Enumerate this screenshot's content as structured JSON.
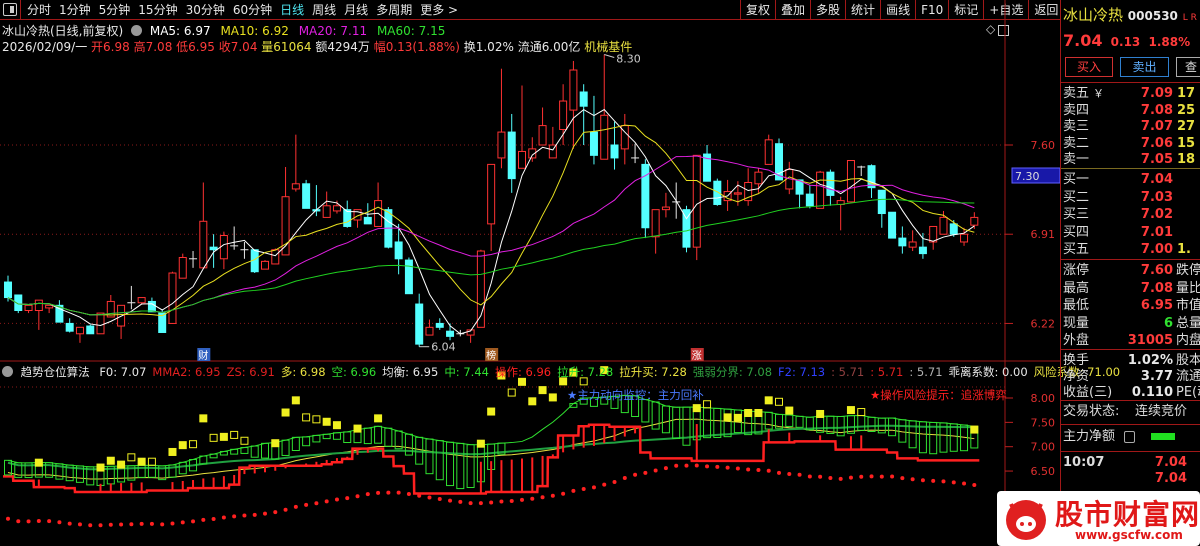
{
  "toolbar": {
    "tabs": [
      {
        "label": "分时",
        "active": false
      },
      {
        "label": "1分钟",
        "active": false
      },
      {
        "label": "5分钟",
        "active": false
      },
      {
        "label": "15分钟",
        "active": false
      },
      {
        "label": "30分钟",
        "active": false
      },
      {
        "label": "60分钟",
        "active": false
      },
      {
        "label": "日线",
        "active": true
      },
      {
        "label": "周线",
        "active": false
      },
      {
        "label": "月线",
        "active": false
      },
      {
        "label": "多周期",
        "active": false
      },
      {
        "label": "更多 >",
        "active": false
      }
    ],
    "buttons": [
      "复权",
      "叠加",
      "多股",
      "统计",
      "画线",
      "F10",
      "标记",
      "+自选",
      "返回"
    ]
  },
  "header": {
    "title": "冰山冷热(日线,前复权)",
    "ma5": "MA5: 6.97",
    "ma10": "MA10: 6.92",
    "ma20": "MA20: 7.11",
    "ma60": "MA60: 7.15",
    "date": "2026/02/09/一",
    "open": "开6.98",
    "high": "高7.08",
    "low": "低6.95",
    "close": "收7.04",
    "volume": "量61064",
    "amount": "额4294万",
    "range": "幅0.13(1.88%)",
    "turnover": "换1.02%",
    "float": "流通6.00亿",
    "sector": "机械基件"
  },
  "colors": {
    "up": "#ff3232",
    "down": "#54ffff",
    "ma5": "#ffffff",
    "ma10": "#e8e020",
    "ma20": "#e020e0",
    "ma60": "#20d020",
    "grid": "#8a1a1a"
  },
  "chart_data": [
    {
      "type": "candlestick",
      "title": "冰山冷热(日线,前复权)",
      "y_ticks": [
        "7.60",
        "6.91",
        "6.22"
      ],
      "current_price_tag": "7.30",
      "high_label": "8.30",
      "low_label": "6.04",
      "markers": [
        {
          "text": "财",
          "index": 19
        },
        {
          "text": "榜",
          "index": 47
        },
        {
          "text": "涨",
          "index": 67
        }
      ],
      "ma_periods": [
        5,
        10,
        20,
        60
      ],
      "candles": [
        [
          6.54,
          6.59,
          6.39,
          6.42
        ],
        [
          6.44,
          6.44,
          6.3,
          6.32
        ],
        [
          6.32,
          6.36,
          6.3,
          6.36
        ],
        [
          6.32,
          6.4,
          6.17,
          6.4
        ],
        [
          6.34,
          6.36,
          6.3,
          6.36
        ],
        [
          6.36,
          6.4,
          6.23,
          6.23
        ],
        [
          6.22,
          6.26,
          6.15,
          6.16
        ],
        [
          6.14,
          6.19,
          6.07,
          6.19
        ],
        [
          6.2,
          6.21,
          6.14,
          6.14
        ],
        [
          6.14,
          6.3,
          6.14,
          6.3
        ],
        [
          6.27,
          6.44,
          6.27,
          6.39
        ],
        [
          6.2,
          6.36,
          6.1,
          6.36
        ],
        [
          6.38,
          6.51,
          6.33,
          6.38
        ],
        [
          6.38,
          6.42,
          6.37,
          6.42
        ],
        [
          6.39,
          6.42,
          6.31,
          6.31
        ],
        [
          6.3,
          6.33,
          6.15,
          6.15
        ],
        [
          6.22,
          6.62,
          6.22,
          6.61
        ],
        [
          6.57,
          6.76,
          6.57,
          6.73
        ],
        [
          6.72,
          6.78,
          6.65,
          6.72
        ],
        [
          6.65,
          7.31,
          6.65,
          7.01
        ],
        [
          6.81,
          6.91,
          6.65,
          6.79
        ],
        [
          6.72,
          6.93,
          6.64,
          6.9
        ],
        [
          6.82,
          6.97,
          6.79,
          6.82
        ],
        [
          6.79,
          6.85,
          6.72,
          6.79
        ],
        [
          6.79,
          6.79,
          6.61,
          6.62
        ],
        [
          6.64,
          6.71,
          6.64,
          6.7
        ],
        [
          6.68,
          6.8,
          6.68,
          6.79
        ],
        [
          6.75,
          7.43,
          6.75,
          7.2
        ],
        [
          7.26,
          7.68,
          7.24,
          7.3
        ],
        [
          7.3,
          7.33,
          7.11,
          7.11
        ],
        [
          7.1,
          7.29,
          7.05,
          7.09
        ],
        [
          7.04,
          7.24,
          7.04,
          7.13
        ],
        [
          7.09,
          7.17,
          7.07,
          7.13
        ],
        [
          7.1,
          7.17,
          6.96,
          6.97
        ],
        [
          7.02,
          7.1,
          6.96,
          7.1
        ],
        [
          7.04,
          7.15,
          6.99,
          6.99
        ],
        [
          6.97,
          7.31,
          6.97,
          7.17
        ],
        [
          7.1,
          7.12,
          6.8,
          6.81
        ],
        [
          6.85,
          6.99,
          6.6,
          6.72
        ],
        [
          6.71,
          6.73,
          6.45,
          6.45
        ],
        [
          6.37,
          6.45,
          6.04,
          6.06
        ],
        [
          6.13,
          6.25,
          6.13,
          6.19
        ],
        [
          6.22,
          6.26,
          6.17,
          6.19
        ],
        [
          6.16,
          6.22,
          6.09,
          6.12
        ],
        [
          6.14,
          6.17,
          6.12,
          6.14
        ],
        [
          6.13,
          6.17,
          6.07,
          6.17
        ],
        [
          6.19,
          6.79,
          6.19,
          6.78
        ],
        [
          6.99,
          7.45,
          6.78,
          7.45
        ],
        [
          7.5,
          8.19,
          7.42,
          7.7
        ],
        [
          7.7,
          7.84,
          7.23,
          7.34
        ],
        [
          7.42,
          8.06,
          7.42,
          7.55
        ],
        [
          7.5,
          7.66,
          7.47,
          7.57
        ],
        [
          7.6,
          7.89,
          7.6,
          7.75
        ],
        [
          7.5,
          7.74,
          7.5,
          7.6
        ],
        [
          7.72,
          8.07,
          7.6,
          7.94
        ],
        [
          7.87,
          8.25,
          7.57,
          8.18
        ],
        [
          8.01,
          8.07,
          7.6,
          7.9
        ],
        [
          7.7,
          7.98,
          7.45,
          7.52
        ],
        [
          7.49,
          8.3,
          7.49,
          7.83
        ],
        [
          7.6,
          7.78,
          7.41,
          7.5
        ],
        [
          7.57,
          7.84,
          7.45,
          7.75
        ],
        [
          7.5,
          7.61,
          7.46,
          7.5
        ],
        [
          7.45,
          7.49,
          6.88,
          6.96
        ],
        [
          6.89,
          7.1,
          6.76,
          7.1
        ],
        [
          7.1,
          7.23,
          7.04,
          7.12
        ],
        [
          7.16,
          7.31,
          7.03,
          7.16
        ],
        [
          7.1,
          7.13,
          6.77,
          6.81
        ],
        [
          6.81,
          7.52,
          6.71,
          7.52
        ],
        [
          7.53,
          7.6,
          7.32,
          7.32
        ],
        [
          7.32,
          7.34,
          7.13,
          7.14
        ],
        [
          7.17,
          7.33,
          7.09,
          7.24
        ],
        [
          7.22,
          7.32,
          7.13,
          7.23
        ],
        [
          7.17,
          7.42,
          7.13,
          7.31
        ],
        [
          7.3,
          7.42,
          7.23,
          7.39
        ],
        [
          7.45,
          7.68,
          7.45,
          7.64
        ],
        [
          7.61,
          7.65,
          7.33,
          7.33
        ],
        [
          7.26,
          7.47,
          7.22,
          7.41
        ],
        [
          7.33,
          7.33,
          7.11,
          7.22
        ],
        [
          7.22,
          7.29,
          7.11,
          7.13
        ],
        [
          7.11,
          7.4,
          7.11,
          7.39
        ],
        [
          7.39,
          7.41,
          7.13,
          7.21
        ],
        [
          7.14,
          7.2,
          6.94,
          7.17
        ],
        [
          7.16,
          7.48,
          7.16,
          7.48
        ],
        [
          7.43,
          7.44,
          7.36,
          7.43
        ],
        [
          7.44,
          7.45,
          7.19,
          7.27
        ],
        [
          7.25,
          7.25,
          6.96,
          7.07
        ],
        [
          7.08,
          7.08,
          6.88,
          6.88
        ],
        [
          6.88,
          6.97,
          6.76,
          6.82
        ],
        [
          6.81,
          6.94,
          6.78,
          6.85
        ],
        [
          6.81,
          6.92,
          6.72,
          6.76
        ],
        [
          6.85,
          6.97,
          6.79,
          6.97
        ],
        [
          6.91,
          7.09,
          6.91,
          7.04
        ],
        [
          6.99,
          7.02,
          6.89,
          6.91
        ],
        [
          6.85,
          6.96,
          6.82,
          6.91
        ],
        [
          6.98,
          7.08,
          6.95,
          7.04
        ]
      ]
    },
    {
      "type": "line",
      "title": "趋势仓位算法",
      "y_ticks": [
        "8.00",
        "7.50",
        "7.00",
        "6.50"
      ],
      "legend": [
        {
          "text": "F0: 7.07",
          "color": "#e8e8e8"
        },
        {
          "text": "MMA2: 6.95",
          "color": "#e02020"
        },
        {
          "text": "ZS: 6.91",
          "color": "#e02020"
        },
        {
          "text": "多: 6.98",
          "color": "#e8e040"
        },
        {
          "text": "空: 6.96",
          "color": "#30e030"
        },
        {
          "text": "均衡: 6.95",
          "color": "#e8e8e8"
        },
        {
          "text": "中: 7.44",
          "color": "#30e030"
        },
        {
          "text": "操作: 6.96",
          "color": "#ff2020"
        },
        {
          "text": "拉升: 7.28",
          "color": "#30e030"
        },
        {
          "text": "拉升买: 7.28",
          "color": "#e8e040"
        },
        {
          "text": "强弱分界: 7.08",
          "color": "#30a040"
        },
        {
          "text": "F2: 7.13",
          "color": "#3040ff"
        },
        {
          "text": ": 5.71",
          "color": "#904040"
        },
        {
          "text": ": 5.71",
          "color": "#e02020"
        },
        {
          "text": ": 5.71",
          "color": "#b0b0b0"
        },
        {
          "text": "乖离系数: 0.00",
          "color": "#e8e8e8"
        },
        {
          "text": "风险系数: 71.00",
          "color": "#e8e040"
        }
      ],
      "notes": {
        "main_force": "★主力动向监控：主力回补",
        "risk": "★操作风险提示：追涨博弈"
      }
    }
  ],
  "quote": {
    "name": "冰山冷热",
    "code": "000530",
    "lr": "L R",
    "price": "7.04",
    "change": "0.13",
    "pct": "1.88%",
    "buttons": [
      "买入",
      "卖出",
      "查"
    ],
    "asks": [
      {
        "label": "卖五",
        "price": "7.09",
        "vol": "17"
      },
      {
        "label": "卖四",
        "price": "7.08",
        "vol": "25"
      },
      {
        "label": "卖三",
        "price": "7.07",
        "vol": "27"
      },
      {
        "label": "卖二",
        "price": "7.06",
        "vol": "15"
      },
      {
        "label": "卖一",
        "price": "7.05",
        "vol": "18"
      }
    ],
    "bids": [
      {
        "label": "买一",
        "price": "7.04",
        "vol": ""
      },
      {
        "label": "买二",
        "price": "7.03",
        "vol": ""
      },
      {
        "label": "买三",
        "price": "7.02",
        "vol": ""
      },
      {
        "label": "买四",
        "price": "7.01",
        "vol": ""
      },
      {
        "label": "买五",
        "price": "7.00",
        "vol": "1."
      }
    ],
    "stats": [
      {
        "label": "涨停",
        "value": "7.60",
        "extra": "跌停",
        "color": "#ff3b3b"
      },
      {
        "label": "最高",
        "value": "7.08",
        "extra": "量比",
        "color": "#ff3b3b"
      },
      {
        "label": "最低",
        "value": "6.95",
        "extra": "市值",
        "color": "#ff3b3b"
      },
      {
        "label": "现量",
        "value": "6",
        "extra": "总量",
        "color": "#30e030"
      },
      {
        "label": "外盘",
        "value": "31005",
        "extra": "内盘",
        "color": "#ff3b3b"
      }
    ],
    "fundamentals": [
      {
        "label": "换手",
        "value": "1.02%",
        "extra": "股本"
      },
      {
        "label": "净资",
        "value": "3.77",
        "extra": "流通"
      },
      {
        "label": "收益(三)",
        "value": "0.110",
        "extra": "PE(动)"
      }
    ],
    "trade_status_label": "交易状态:",
    "trade_status": "连续竞价",
    "main_net_label": "主力净额",
    "ticks": [
      {
        "time": "10:07",
        "price": "7.04"
      },
      {
        "time": "",
        "price": "7.04"
      }
    ]
  },
  "logo": {
    "name": "股市财富网",
    "url": "www.gscfw.com"
  }
}
